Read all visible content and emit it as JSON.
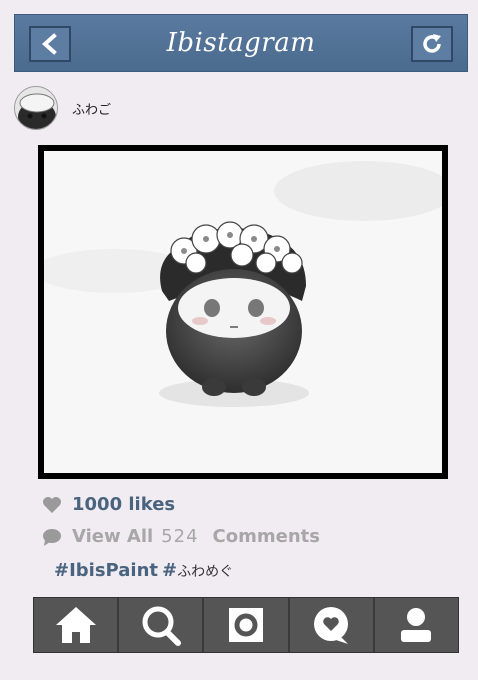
{
  "header": {
    "title": "Ibistagram",
    "back_icon": "chevron-left-icon",
    "refresh_icon": "refresh-icon"
  },
  "post": {
    "username": "ふわご",
    "likes": "1000 likes",
    "comments_prefix": "View All",
    "comments_count": "524",
    "comments_suffix": "Comments",
    "hashtag_main": "#IbisPaint",
    "hashtag_hash": "#",
    "hashtag_jp": "ふわめぐ"
  },
  "tabbar": {
    "items": [
      "home-icon",
      "search-icon",
      "camera-icon",
      "chat-heart-icon",
      "profile-icon"
    ]
  },
  "colors": {
    "header_bg": "#5a7a9f",
    "link_blue": "#4a6480",
    "gray_text": "#a7a7a7",
    "tabbar_bg": "#555555",
    "page_bg": "#f1ecf1"
  }
}
